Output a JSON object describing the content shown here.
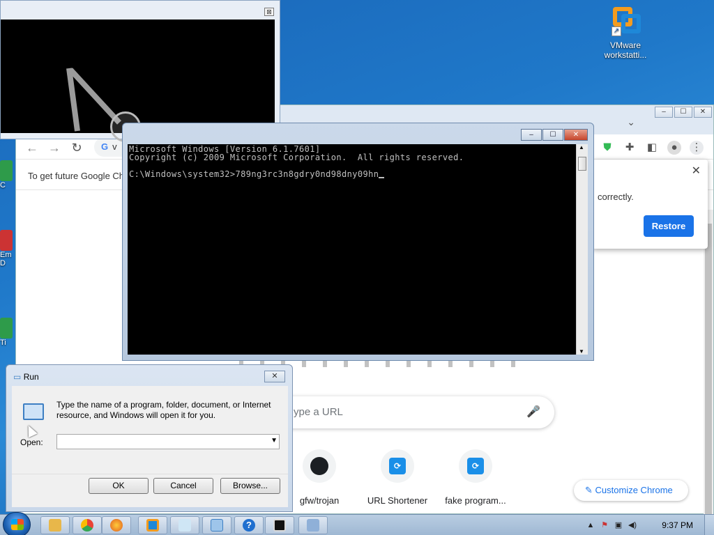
{
  "desktop": {
    "icons": [
      {
        "label": "VMware workstatti..."
      }
    ],
    "left_labels": [
      "C",
      "Em",
      "D",
      "Ti"
    ]
  },
  "magnifier": {
    "close_label": "⊠"
  },
  "chrome": {
    "window_buttons": [
      "‒",
      "☐",
      "✕"
    ],
    "tab_chevron": "⌄",
    "omnibox_text": "v",
    "info_bar_text": "To get future Google Ch",
    "restore_popup": {
      "message": "correctly.",
      "button_label": "Restore"
    },
    "search_placeholder": "ype a URL",
    "shortcuts": [
      {
        "label": "gfw/trojan"
      },
      {
        "label": "URL Shortener"
      },
      {
        "label": "fake program..."
      }
    ],
    "customize_label": "Customize Chrome"
  },
  "cmd": {
    "lines": [
      "Microsoft Windows [Version 6.1.7601]",
      "Copyright (c) 2009 Microsoft Corporation.  All rights reserved.",
      "",
      "C:\\Windows\\system32>789ng3rc3n8gdry0nd98dny09hn"
    ]
  },
  "run_dialog": {
    "title": "Run",
    "description": "Type the name of a program, folder, document, or Internet resource, and Windows will open it for you.",
    "open_label": "Open:",
    "input_value": "",
    "buttons": {
      "ok": "OK",
      "cancel": "Cancel",
      "browse": "Browse..."
    }
  },
  "taskbar": {
    "clock": "9:37 PM"
  }
}
